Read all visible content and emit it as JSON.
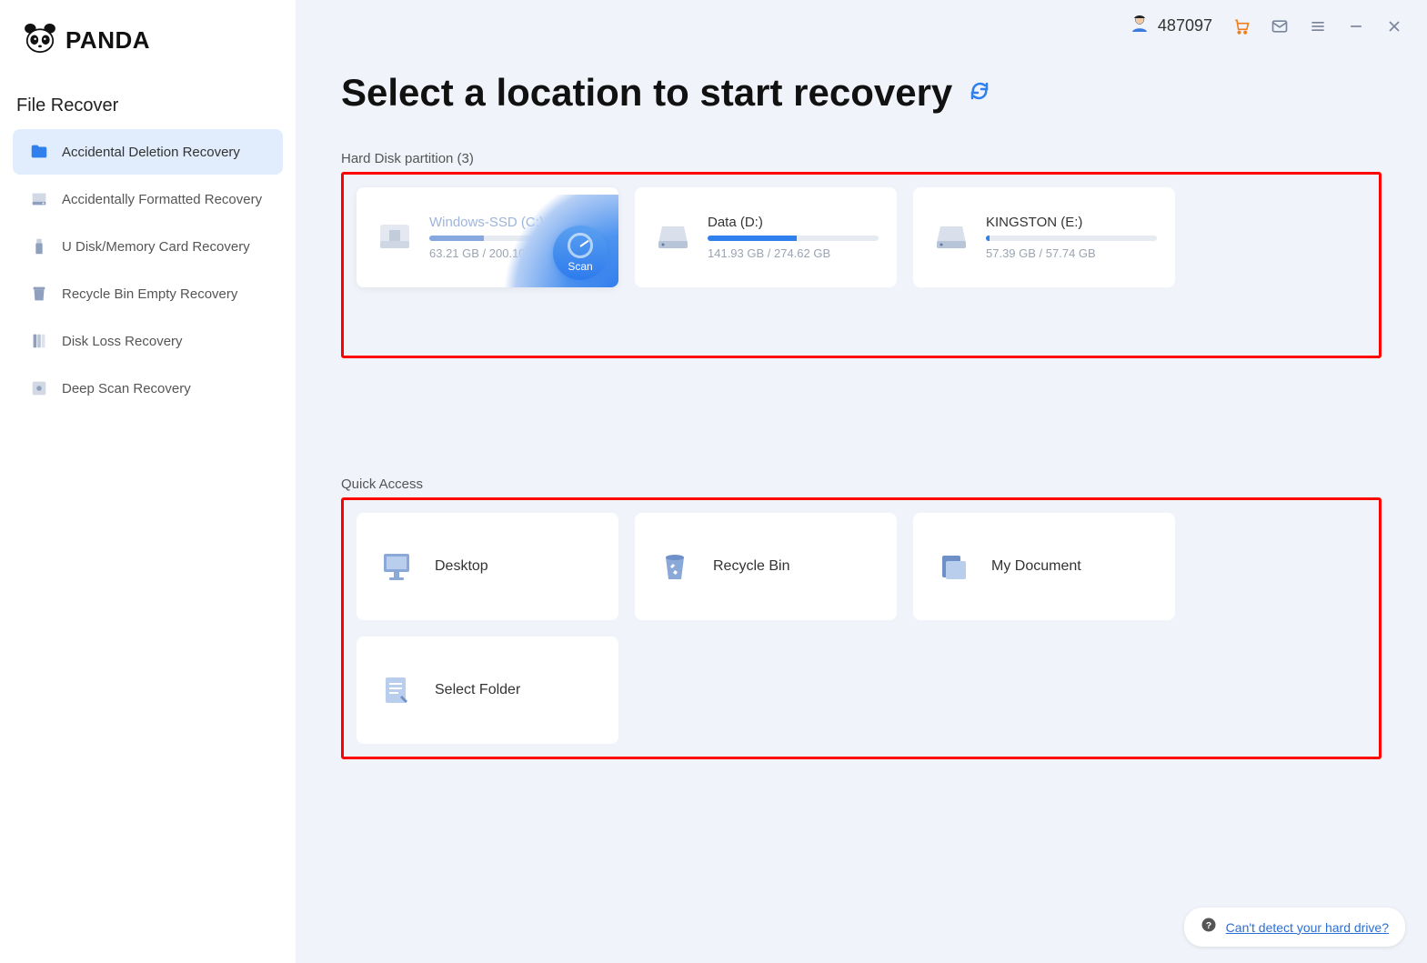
{
  "brand": "PANDA",
  "header": {
    "user_id": "487097"
  },
  "sidebar": {
    "title": "File Recover",
    "items": [
      {
        "label": "Accidental Deletion Recovery",
        "active": true
      },
      {
        "label": "Accidentally Formatted Recovery",
        "active": false
      },
      {
        "label": "U Disk/Memory Card Recovery",
        "active": false
      },
      {
        "label": "Recycle Bin Empty Recovery",
        "active": false
      },
      {
        "label": "Disk Loss Recovery",
        "active": false
      },
      {
        "label": "Deep Scan Recovery",
        "active": false
      }
    ]
  },
  "main": {
    "title": "Select a location to start recovery",
    "partition_label": "Hard Disk partition   (3)",
    "partitions": [
      {
        "name": "Windows-SSD   (C:)",
        "used": 63.21,
        "total": 200.1,
        "size_text": "63.21 GB / 200.10 GB",
        "fill_pct": 32,
        "hover": true,
        "scan_label": "Scan"
      },
      {
        "name": "Data   (D:)",
        "used": 141.93,
        "total": 274.62,
        "size_text": "141.93 GB / 274.62 GB",
        "fill_pct": 52,
        "hover": false
      },
      {
        "name": "KINGSTON   (E:)",
        "used": 57.39,
        "total": 57.74,
        "size_text": "57.39 GB / 57.74 GB",
        "fill_pct": 2,
        "hover": false
      }
    ],
    "quick_access_label": "Quick Access",
    "quick_access": [
      {
        "label": "Desktop",
        "icon": "desktop"
      },
      {
        "label": "Recycle Bin",
        "icon": "recycle"
      },
      {
        "label": "My Document",
        "icon": "document"
      },
      {
        "label": "Select Folder",
        "icon": "folder"
      }
    ]
  },
  "help_link": "Can't detect your hard drive?"
}
